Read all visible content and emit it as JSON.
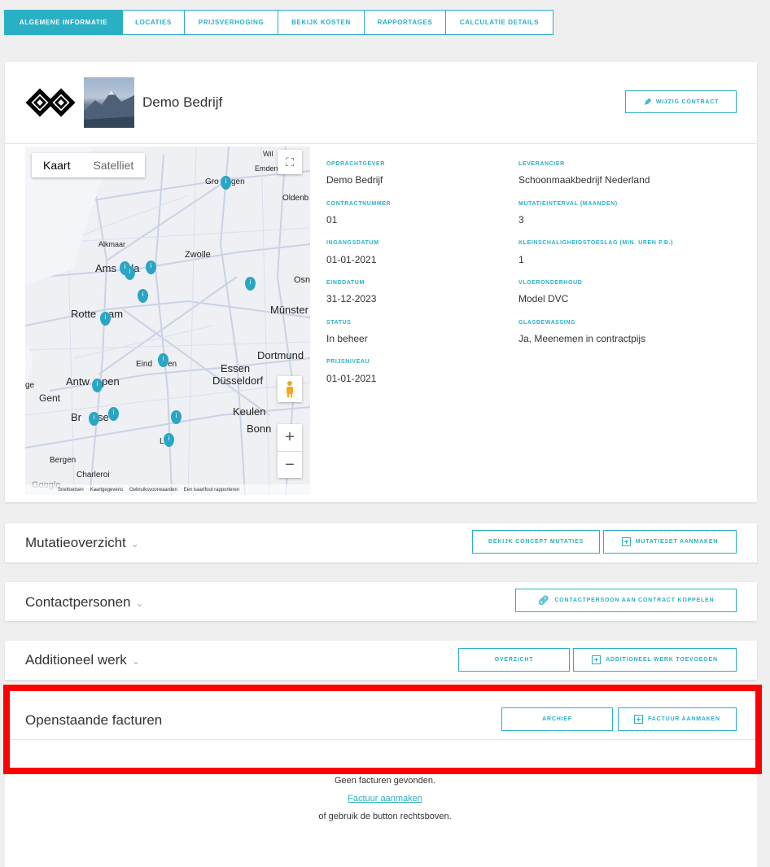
{
  "tabs": [
    {
      "label": "ALGEMENE INFORMATIE",
      "active": true
    },
    {
      "label": "LOCATIES",
      "active": false
    },
    {
      "label": "PRIJSVERHOGING",
      "active": false
    },
    {
      "label": "BEKIJK KOSTEN",
      "active": false
    },
    {
      "label": "RAPPORTAGES",
      "active": false
    },
    {
      "label": "CALCULATIE DETAILS",
      "active": false
    }
  ],
  "header": {
    "company_name": "Demo Bedrijf",
    "edit_button": "WIJZIG CONTRACT"
  },
  "map": {
    "toggle_map": "Kaart",
    "toggle_satellite": "Satelliet",
    "labels": {
      "wil": "Wil",
      "emden": "Emden",
      "groningen_a": "Gro",
      "groningen_b": "gen",
      "oldenburg": "Oldenb",
      "alkmaar": "Alkmaar",
      "zwolle": "Zwolle",
      "amsterdam_a": "Ams",
      "amsterdam_b": "da",
      "osnabruck": "Osn",
      "rotterdam_a": "Rotte",
      "rotterdam_b": "am",
      "munster": "Münster",
      "dortmund": "Dortmund",
      "eindhoven_a": "Eind",
      "eindhoven_b": "ven",
      "essen": "Essen",
      "antwerpen_a": "Antw",
      "antwerpen_b": "pen",
      "dusseldorf": "Düsseldorf",
      "ge": "ge",
      "gent": "Gent",
      "keulen": "Keulen",
      "brussel_a": "Br",
      "brussel_b": "se",
      "bonn": "Bonn",
      "li": "Li",
      "bergen": "Bergen",
      "charleroi": "Charleroi",
      "google": "Google"
    },
    "footer": [
      "Sneltoetsen",
      "Kaartgegevens",
      "Gebruiksvoorwaarden",
      "Een kaartfout rapporteren"
    ]
  },
  "details": {
    "opdrachtgever_label": "OPDRACHTGEVER",
    "opdrachtgever": "Demo Bedrijf",
    "contractnummer_label": "CONTRACTNUMMER",
    "contractnummer": "01",
    "ingangsdatum_label": "INGANGSDATUM",
    "ingangsdatum": "01-01-2021",
    "einddatum_label": "EINDDATUM",
    "einddatum": "31-12-2023",
    "status_label": "STATUS",
    "status": "In beheer",
    "prijsniveau_label": "PRIJSNIVEAU",
    "prijsniveau": "01-01-2021",
    "leverancier_label": "LEVERANCIER",
    "leverancier": "Schoonmaakbedrijf Nederland",
    "mutatieinterval_label": "MUTATIEINTERVAL (MAANDEN)",
    "mutatieinterval": "3",
    "kleinschalig_label": "KLEINSCHALIGHEIDSTOESLAG (MIN. UREN P.B.)",
    "kleinschalig": "1",
    "vloeronderhoud_label": "VLOERONDERHOUD",
    "vloeronderhoud": "Model DVC",
    "glasbewassing_label": "GLASBEWASSING",
    "glasbewassing": "Ja, Meenemen in contractpijs"
  },
  "sections": {
    "mutatie": {
      "title": "Mutatieoverzicht",
      "btn1": "BEKIJK CONCEPT MUTATIES",
      "btn2": "MUTATIESET AANMAKEN"
    },
    "contact": {
      "title": "Contactpersonen",
      "btn1": "CONTACTPERSOON AAN CONTRACT KOPPELEN"
    },
    "additioneel": {
      "title": "Additioneel werk",
      "btn1": "OVERZICHT",
      "btn2": "ADDITIONEEL WERK TOEVOEGEN"
    },
    "facturen": {
      "title": "Openstaande facturen",
      "btn1": "ARCHIEF",
      "btn2": "FACTUUR AANMAKEN"
    }
  },
  "empty": {
    "line1": "Geen facturen gevonden.",
    "link": "Factuur aanmaken",
    "line2": "of gebruik de button rechtsboven."
  },
  "colors": {
    "accent": "#2ab0c4",
    "highlight": "#ff0000"
  }
}
